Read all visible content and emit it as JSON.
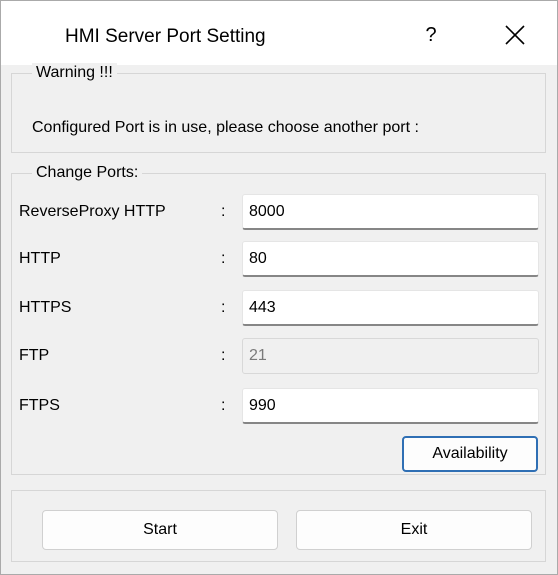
{
  "window": {
    "title": "HMI Server Port Setting",
    "help_glyph": "?",
    "close_icon": "close-icon"
  },
  "warning": {
    "legend": "Warning !!!",
    "message": "Configured Port is in use, please choose another port :"
  },
  "ports": {
    "legend": "Change Ports:",
    "separator": ":",
    "rows": [
      {
        "label": "ReverseProxy HTTP",
        "value": "8000",
        "enabled": true
      },
      {
        "label": "HTTP",
        "value": "80",
        "enabled": true
      },
      {
        "label": "HTTPS",
        "value": "443",
        "enabled": true
      },
      {
        "label": "FTP",
        "value": "21",
        "enabled": false
      },
      {
        "label": "FTPS",
        "value": "990",
        "enabled": true
      }
    ],
    "availability_label": "Availability"
  },
  "actions": {
    "start_label": "Start",
    "exit_label": "Exit"
  },
  "colors": {
    "focus_border": "#2f6fb4",
    "dialog_bg": "#f0f0f0"
  }
}
